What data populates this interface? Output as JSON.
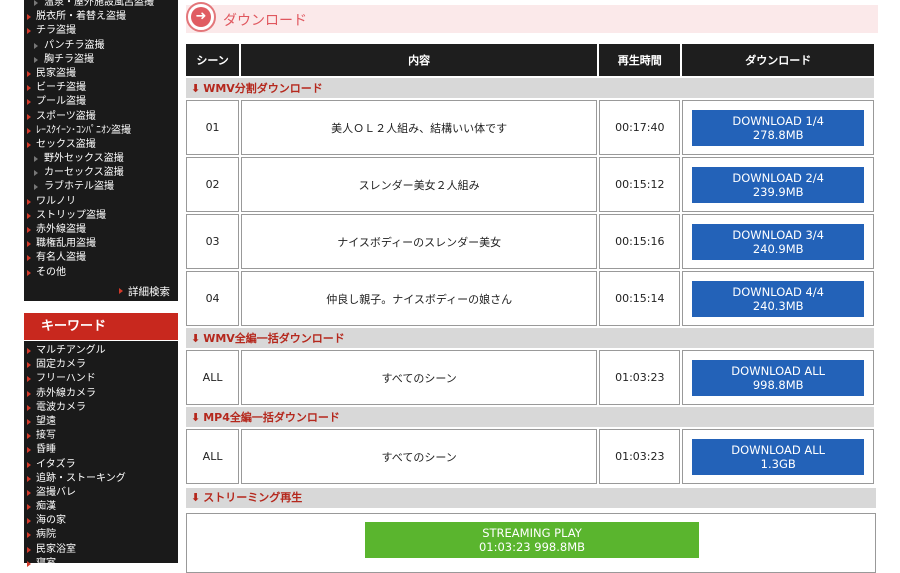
{
  "sidebar": {
    "categories": [
      {
        "label": "温泉・屋外施設風呂盗撮",
        "sub": true
      },
      {
        "label": "脱衣所・着替え盗撮",
        "sub": false
      },
      {
        "label": "チラ盗撮",
        "sub": false
      },
      {
        "label": "パンチラ盗撮",
        "sub": true
      },
      {
        "label": "胸チラ盗撮",
        "sub": true
      },
      {
        "label": "民家盗撮",
        "sub": false
      },
      {
        "label": "ビーチ盗撮",
        "sub": false
      },
      {
        "label": "プール盗撮",
        "sub": false
      },
      {
        "label": "スポーツ盗撮",
        "sub": false
      },
      {
        "label": "ﾚｰｽｸｲｰﾝ･ｺﾝﾊﾟﾆｵﾝ盗撮",
        "sub": false
      },
      {
        "label": "セックス盗撮",
        "sub": false
      },
      {
        "label": "野外セックス盗撮",
        "sub": true
      },
      {
        "label": "カーセックス盗撮",
        "sub": true
      },
      {
        "label": "ラブホテル盗撮",
        "sub": true
      },
      {
        "label": "ワルノリ",
        "sub": false
      },
      {
        "label": "ストリップ盗撮",
        "sub": false
      },
      {
        "label": "赤外線盗撮",
        "sub": false
      },
      {
        "label": "職権乱用盗撮",
        "sub": false
      },
      {
        "label": "有名人盗撮",
        "sub": false
      },
      {
        "label": "その他",
        "sub": false
      }
    ],
    "detail_search": "詳細検索",
    "keyword_title": "キーワード",
    "keywords": [
      "マルチアングル",
      "固定カメラ",
      "フリーハンド",
      "赤外線カメラ",
      "電波カメラ",
      "望遠",
      "接写",
      "昏睡",
      "イタズラ",
      "追跡・ストーキング",
      "盗撮バレ",
      "痴漢",
      "海の家",
      "病院",
      "民家浴室",
      "寝室"
    ]
  },
  "main": {
    "title": "ダウンロード",
    "columns": [
      "シーン",
      "内容",
      "再生時間",
      "ダウンロード"
    ],
    "sections": [
      {
        "title": "WMV分割ダウンロード",
        "rows": [
          {
            "scene": "01",
            "content": "美人ＯＬ２人組み、結構いい体です",
            "time": "00:17:40",
            "btn1": "DOWNLOAD 1/4",
            "btn2": "278.8MB"
          },
          {
            "scene": "02",
            "content": "スレンダー美女２人組み",
            "time": "00:15:12",
            "btn1": "DOWNLOAD 2/4",
            "btn2": "239.9MB"
          },
          {
            "scene": "03",
            "content": "ナイスボディーのスレンダー美女",
            "time": "00:15:16",
            "btn1": "DOWNLOAD 3/4",
            "btn2": "240.9MB"
          },
          {
            "scene": "04",
            "content": "仲良し親子。ナイスボディーの娘さん",
            "time": "00:15:14",
            "btn1": "DOWNLOAD 4/4",
            "btn2": "240.3MB"
          }
        ]
      },
      {
        "title": "WMV全編一括ダウンロード",
        "rows": [
          {
            "scene": "ALL",
            "content": "すべてのシーン",
            "time": "01:03:23",
            "btn1": "DOWNLOAD ALL",
            "btn2": "998.8MB"
          }
        ]
      },
      {
        "title": "MP4全編一括ダウンロード",
        "rows": [
          {
            "scene": "ALL",
            "content": "すべてのシーン",
            "time": "01:03:23",
            "btn1": "DOWNLOAD ALL",
            "btn2": "1.3GB"
          }
        ]
      }
    ],
    "streaming": {
      "title": "ストリーミング再生",
      "btn1": "STREAMING PLAY",
      "btn2": "01:03:23 998.8MB"
    }
  },
  "colors": {
    "accent_red": "#c8281e",
    "download_blue": "#2362b8",
    "stream_green": "#5ab52e",
    "header_pink": "#fbe9ea"
  }
}
